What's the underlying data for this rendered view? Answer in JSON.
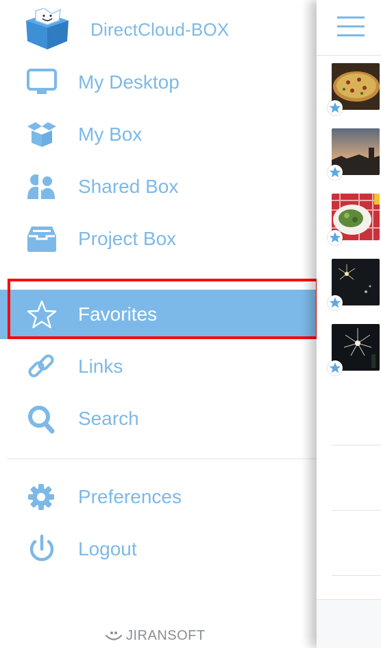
{
  "app": {
    "name": "DirectCloud-BOX"
  },
  "colors": {
    "accent": "#7cb9e8",
    "active_bg": "#7cb9e8",
    "highlight_frame": "#ff0000",
    "footer_text": "#8a8f94"
  },
  "sidebar": {
    "items": [
      {
        "label": "My Desktop",
        "icon": "monitor-icon"
      },
      {
        "label": "My Box",
        "icon": "box-icon"
      },
      {
        "label": "Shared Box",
        "icon": "people-icon"
      },
      {
        "label": "Project Box",
        "icon": "inbox-tray-icon"
      },
      {
        "label": "Favorites",
        "icon": "star-icon",
        "active": true
      },
      {
        "label": "Links",
        "icon": "link-icon"
      },
      {
        "label": "Search",
        "icon": "search-icon"
      },
      {
        "label": "Preferences",
        "icon": "gear-icon"
      },
      {
        "label": "Logout",
        "icon": "power-icon"
      }
    ]
  },
  "footer": {
    "brand": "JIRANSOFT"
  },
  "main": {
    "thumbnails": [
      {
        "subject": "pizza",
        "favorite": true
      },
      {
        "subject": "sunset-sky",
        "favorite": true
      },
      {
        "subject": "salad-plate",
        "favorite": true
      },
      {
        "subject": "fireworks",
        "favorite": true
      },
      {
        "subject": "fireworks",
        "favorite": true
      }
    ]
  }
}
